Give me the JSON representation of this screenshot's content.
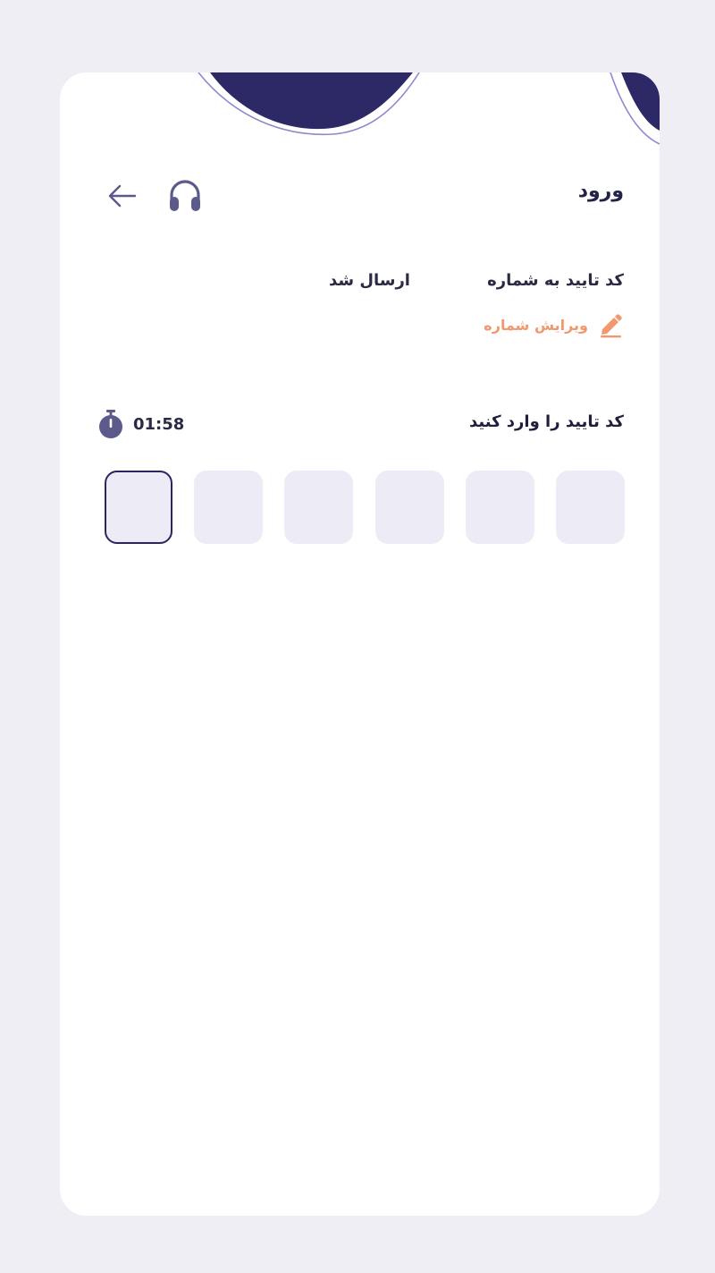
{
  "header": {
    "title": "ورود",
    "back_icon": "arrow-left-icon",
    "support_icon": "headphones-icon"
  },
  "verification": {
    "sent_prefix": "کد تایید به شماره",
    "sent_suffix": "ارسال شد",
    "edit_label": "ویرایش شماره",
    "edit_icon": "pencil-icon"
  },
  "code_entry": {
    "label": "کد تایید را وارد کنید",
    "timer": "01:58",
    "timer_icon": "stopwatch-icon",
    "digits": [
      "",
      "",
      "",
      "",
      "",
      ""
    ]
  },
  "colors": {
    "brand_dark": "#2a275f",
    "accent_orange": "#f3986e",
    "input_bg": "#ecebf6",
    "page_bg": "#efeef5"
  }
}
